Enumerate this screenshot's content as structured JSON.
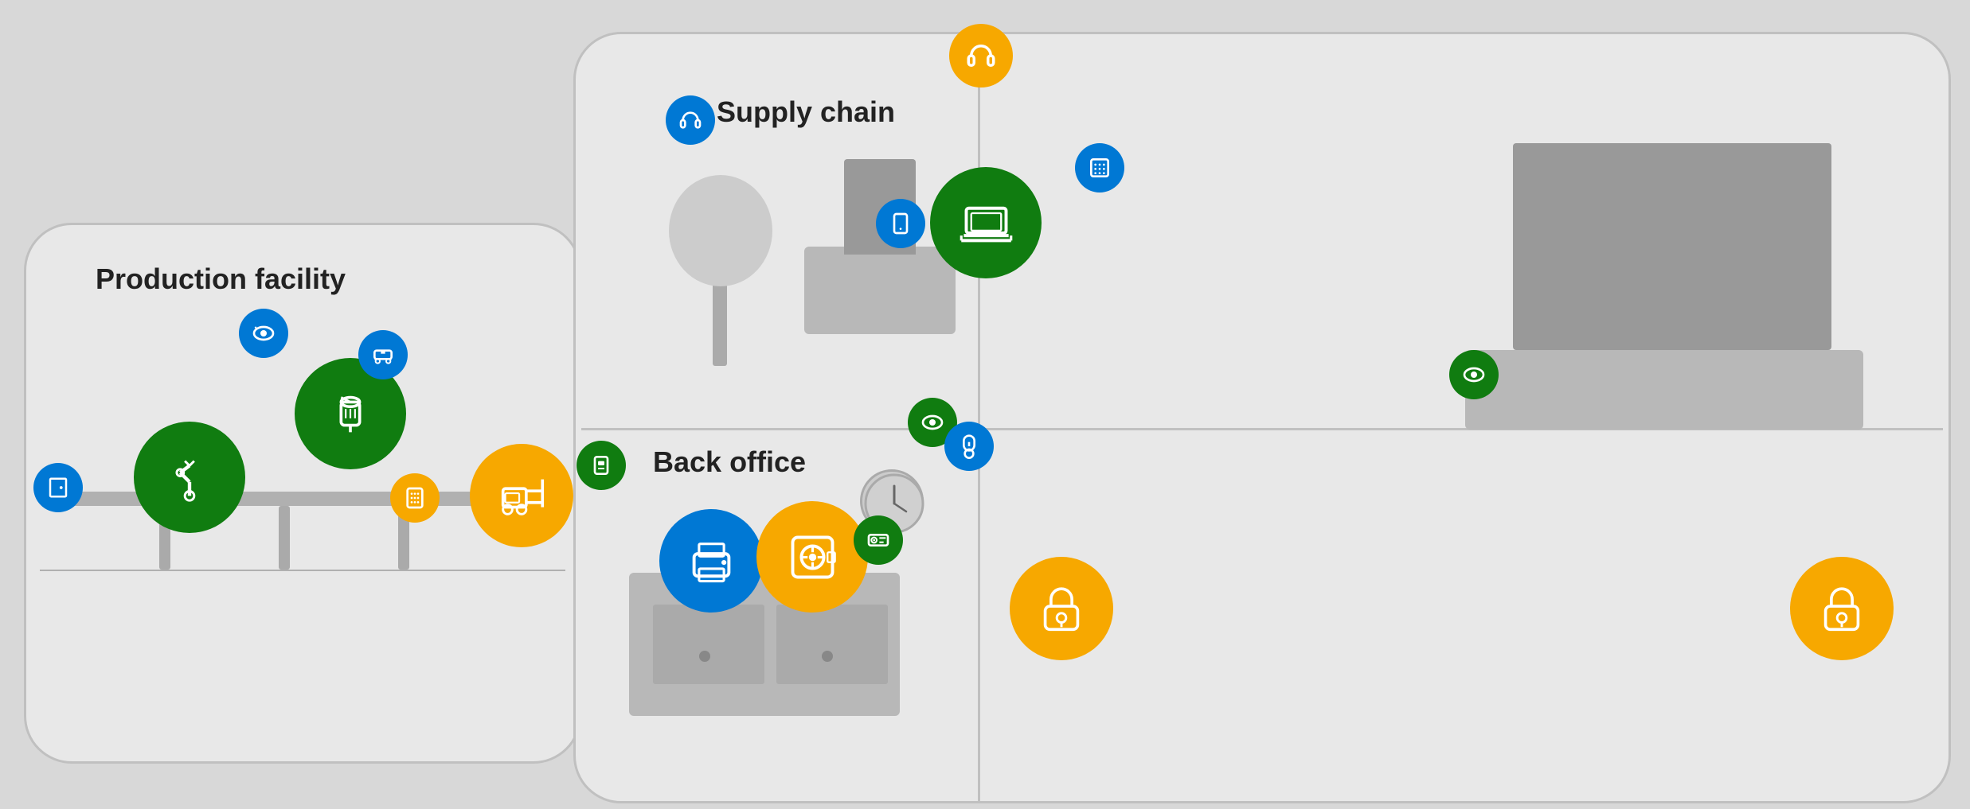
{
  "labels": {
    "production": "Production facility",
    "back_office": "Back office",
    "supply_chain": "Supply chain"
  },
  "colors": {
    "blue": "#0078d4",
    "green": "#107c10",
    "yellow": "#f7a800",
    "bg": "#d8d8d8",
    "building": "#e8e8e8"
  },
  "icons": {
    "camera": "security-camera",
    "robot_arm": "robot-arm",
    "industrial_tank": "industrial-tank",
    "conveyor_machine": "conveyor-machine",
    "forklift": "forklift",
    "keypad": "keypad",
    "door_panel": "door-panel",
    "printer": "printer",
    "safe": "safe",
    "dvr": "dvr",
    "lock": "lock",
    "laptop": "laptop",
    "phone": "mobile-phone",
    "headset": "headset",
    "phone_system": "phone-system",
    "thermostat": "thermostat",
    "camera2": "security-camera-2",
    "access_control": "access-control"
  }
}
